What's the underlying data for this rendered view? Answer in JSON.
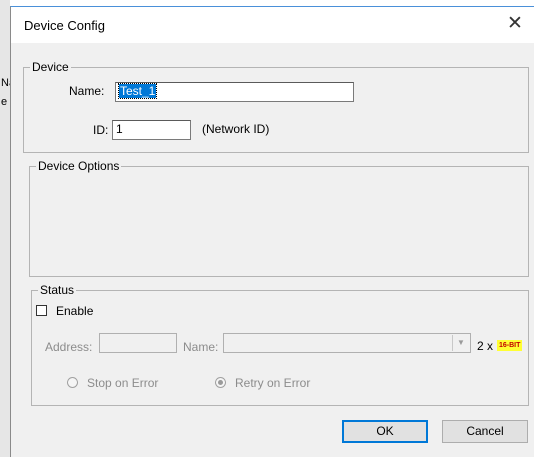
{
  "background": {
    "fragments": [
      "Nå",
      "e"
    ]
  },
  "dialog": {
    "title": "Device Config",
    "close_icon": "close-icon"
  },
  "device_group": {
    "legend": "Device",
    "name_label": "Name:",
    "name_value": "Test_1",
    "id_label": "ID:",
    "id_value": "1",
    "id_hint": "(Network ID)"
  },
  "options_group": {
    "legend": "Device Options"
  },
  "status_group": {
    "legend": "Status",
    "enable_label": "Enable",
    "enable_checked": false,
    "address_label": "Address:",
    "address_value": "",
    "name_label": "Name:",
    "name_value": "",
    "multiplier": "2 x",
    "badge": "16-BIT",
    "radios": [
      {
        "label": "Stop on Error",
        "checked": false
      },
      {
        "label": "Retry on Error",
        "checked": true
      }
    ]
  },
  "buttons": {
    "ok": "OK",
    "cancel": "Cancel"
  },
  "colors": {
    "accent": "#0078d7",
    "badge_bg": "#ffff33",
    "badge_text": "#c00000"
  }
}
